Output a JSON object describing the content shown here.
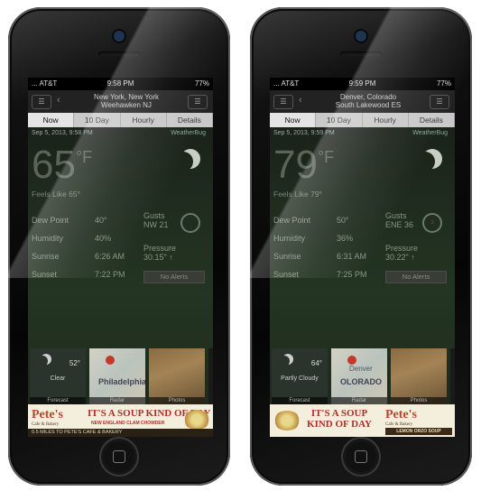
{
  "phones": [
    {
      "status": {
        "carrier": "... AT&T",
        "time": "9:58 PM",
        "battery": "77%"
      },
      "location": {
        "line1": "New York, New York",
        "line2": "Weehawken NJ"
      },
      "tabs": [
        "Now",
        "10 Day",
        "Hourly",
        "Details"
      ],
      "date": "Sep 5, 2013, 9:58 PM",
      "brand": "WeatherBug",
      "temp": "65",
      "unit": "°F",
      "feels": "Feels Like 65°",
      "stats": [
        {
          "label": "Dew Point",
          "value": "40°"
        },
        {
          "label": "Humidity",
          "value": "40%"
        },
        {
          "label": "Sunrise",
          "value": "6:26 AM"
        },
        {
          "label": "Sunset",
          "value": "7:22 PM"
        }
      ],
      "gusts": {
        "label": "Gusts",
        "value": "NW 21"
      },
      "dial": "",
      "pressure": {
        "label": "Pressure",
        "value": "30.15\" ↑"
      },
      "alerts": "No Alerts",
      "tiles": [
        {
          "cap": "Forecast",
          "cond": "Clear",
          "temp": "52°"
        },
        {
          "cap": "Radar",
          "map1": "",
          "map2": "Philadelphia"
        },
        {
          "cap": "Photos"
        }
      ],
      "ad": {
        "logo": "Pete's",
        "logo_sub": "Cafe & Bakery",
        "headline": "IT'S A SOUP KIND OF DAY",
        "sub": "NEW ENGLAND CLAM CHOWDER",
        "strip": "0.5 MILES TO PETE'S CAFE & BAKERY"
      }
    },
    {
      "status": {
        "carrier": "... AT&T",
        "time": "9:59 PM",
        "battery": "77%"
      },
      "location": {
        "line1": "Denver, Colorado",
        "line2": "South Lakewood ES"
      },
      "tabs": [
        "Now",
        "10 Day",
        "Hourly",
        "Details"
      ],
      "date": "Sep 5, 2013, 9:59 PM",
      "brand": "WeatherBug",
      "temp": "79",
      "unit": "°F",
      "feels": "Feels Like 79°",
      "stats": [
        {
          "label": "Dew Point",
          "value": "50°"
        },
        {
          "label": "Humidity",
          "value": "36%"
        },
        {
          "label": "Sunrise",
          "value": "6:31 AM"
        },
        {
          "label": "Sunset",
          "value": "7:25 PM"
        }
      ],
      "gusts": {
        "label": "Gusts",
        "value": "ENE 36"
      },
      "dial": "3",
      "pressure": {
        "label": "Pressure",
        "value": "30.22\" ↑"
      },
      "alerts": "No Alerts",
      "tiles": [
        {
          "cap": "Forecast",
          "cond": "Partly Cloudy",
          "temp": "64°"
        },
        {
          "cap": "Radar",
          "map1": "Denver",
          "map2": "OLORADO"
        },
        {
          "cap": "Photos"
        }
      ],
      "ad": {
        "logo": "Pete's",
        "logo_sub": "Cafe & Bakery",
        "headline": "IT'S A SOUP KIND OF DAY",
        "sub": "LEMON ORZO SOUP",
        "strip": ""
      }
    }
  ]
}
